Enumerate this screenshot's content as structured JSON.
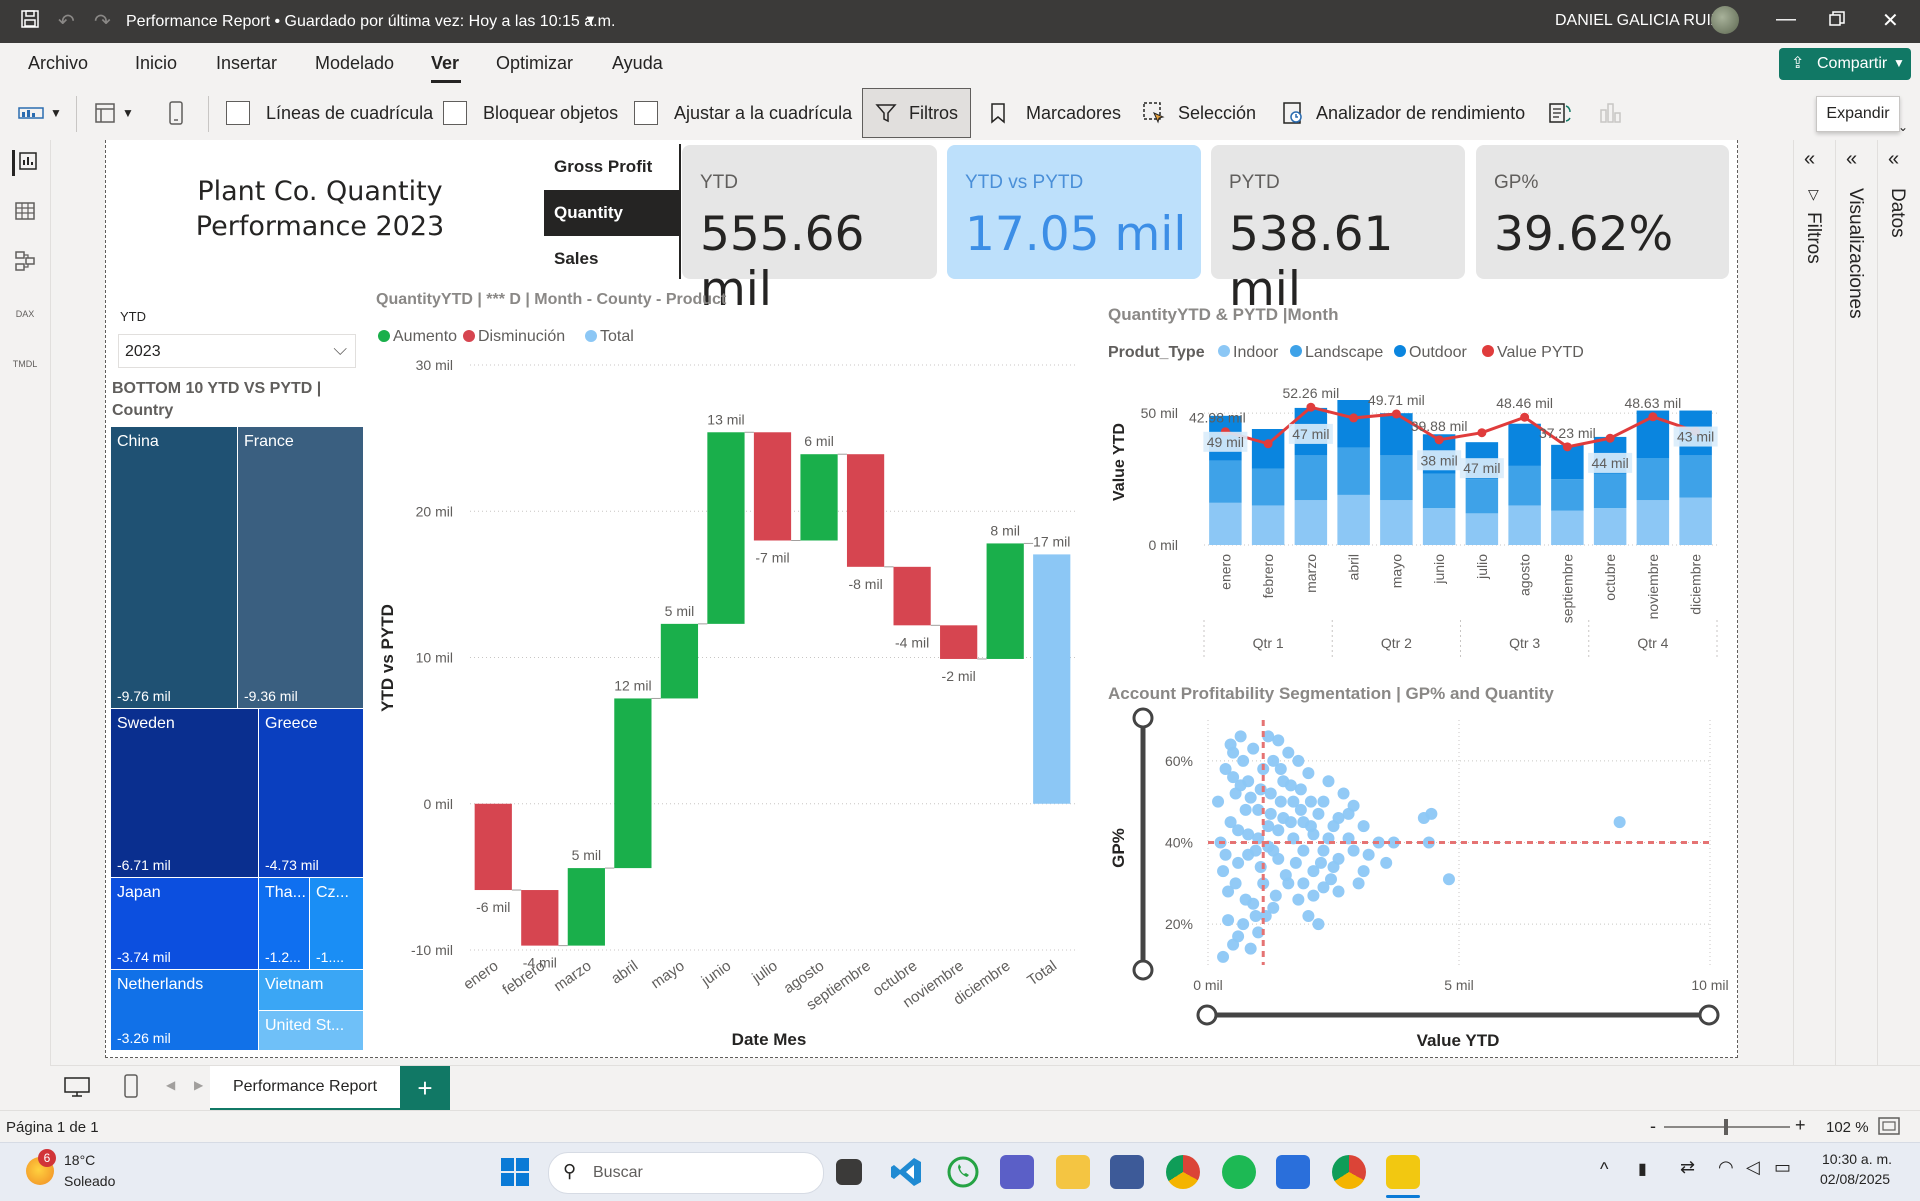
{
  "titlebar": {
    "title": "Performance Report • Guardado por última vez: Hoy a las 10:15 a.m.",
    "user": "DANIEL GALICIA RUIZ"
  },
  "menu": [
    "Archivo",
    "Inicio",
    "Insertar",
    "Modelado",
    "Ver",
    "Optimizar",
    "Ayuda"
  ],
  "share_label": "Compartir",
  "ribbon": {
    "gridlines": "Líneas de cuadrícula",
    "lock": "Bloquear objetos",
    "snap": "Ajustar a la cuadrícula",
    "filters": "Filtros",
    "bookmarks": "Marcadores",
    "selection": "Selección",
    "perf": "Analizador de rendimiento"
  },
  "tooltip": "Expandir",
  "panes": {
    "filters": "Filtros",
    "visualizations": "Visualizaciones",
    "data": "Datos"
  },
  "report": {
    "title_line1": "Plant Co. Quantity",
    "title_line2": "Performance 2023",
    "slicer_buttons": [
      "Gross Profit",
      "Quantity",
      "Sales"
    ],
    "year_slicer": {
      "label": "YTD",
      "value": "2023"
    },
    "treemap_title_l1": "BOTTOM 10 YTD VS PYTD |",
    "treemap_title_l2": "Country"
  },
  "cards": [
    {
      "label": "YTD",
      "value": "555.66 mil"
    },
    {
      "label": "YTD vs PYTD",
      "value": "17.05 mil"
    },
    {
      "label": "PYTD",
      "value": "538.61 mil"
    },
    {
      "label": "GP%",
      "value": "39.62%"
    }
  ],
  "treemap": [
    {
      "name": "China",
      "value": "-9.76 mil",
      "color": "#1f5173"
    },
    {
      "name": "France",
      "value": "-9.36 mil",
      "color": "#3a5f80"
    },
    {
      "name": "Sweden",
      "value": "-6.71 mil",
      "color": "#0a2f8f"
    },
    {
      "name": "Greece",
      "value": "-4.73 mil",
      "color": "#0a3fbf"
    },
    {
      "name": "Japan",
      "value": "-3.74 mil",
      "color": "#0c4fdf"
    },
    {
      "name": "Tha...",
      "value": "-1.2...",
      "color": "#0f6ff0"
    },
    {
      "name": "Cz...",
      "value": "-1....",
      "color": "#1a8ef5"
    },
    {
      "name": "Netherlands",
      "value": "-3.26 mil",
      "color": "#1171e8"
    },
    {
      "name": "Vietnam",
      "value": "",
      "color": "#3aa6f5"
    },
    {
      "name": "United St...",
      "value": "",
      "color": "#6fc0f8"
    }
  ],
  "chart_data": [
    {
      "type": "waterfall",
      "title": "QuantityYTD | *** D | Month - County - Product",
      "legend": [
        "Aumento",
        "Disminución",
        "Total"
      ],
      "colors": {
        "increase": "#1aaf4b",
        "decrease": "#d64550",
        "total": "#8cc7f5"
      },
      "xlabel": "Date Mes",
      "ylabel": "YTD vs PYTD",
      "ylim": [
        -10,
        30
      ],
      "yticks": [
        "30 mil",
        "20 mil",
        "10 mil",
        "0 mil",
        "-10 mil"
      ],
      "ytick_values": [
        30,
        20,
        10,
        0,
        -10
      ],
      "categories": [
        "enero",
        "febrero",
        "marzo",
        "abril",
        "mayo",
        "junio",
        "julio",
        "agosto",
        "septiembre",
        "octubre",
        "noviembre",
        "diciembre",
        "Total"
      ],
      "values": [
        -5.9,
        -3.8,
        5.3,
        11.6,
        5.1,
        13.1,
        -7.4,
        5.9,
        -7.7,
        -4.0,
        -2.3,
        7.9,
        17.05
      ],
      "data_labels": [
        "-6 mil",
        "-4 mil",
        "5 mil",
        "12 mil",
        "5 mil",
        "13 mil",
        "-7 mil",
        "6 mil",
        "-8 mil",
        "-4 mil",
        "-2 mil",
        "8 mil",
        "17 mil"
      ]
    },
    {
      "type": "bar",
      "stacked": true,
      "title": "QuantityYTD & PYTD |Month",
      "legend_title": "Produt_Type",
      "ylabel": "Value YTD",
      "ylim": [
        0,
        55
      ],
      "yticks": [
        "50 mil",
        "0 mil"
      ],
      "ytick_values": [
        50,
        0
      ],
      "categories": [
        "enero",
        "febrero",
        "marzo",
        "abril",
        "mayo",
        "junio",
        "julio",
        "agosto",
        "septiembre",
        "octubre",
        "noviembre",
        "diciembre"
      ],
      "quarters": [
        "Qtr 1",
        "Qtr 2",
        "Qtr 3",
        "Qtr 4"
      ],
      "series": [
        {
          "name": "Indoor",
          "color": "#8cc7f5",
          "values": [
            16,
            15,
            17,
            19,
            17,
            14,
            12,
            15,
            13,
            14,
            17,
            18
          ]
        },
        {
          "name": "Landscape",
          "color": "#3ea2e8",
          "values": [
            16,
            14,
            17,
            18,
            17,
            13,
            13,
            15,
            12,
            13,
            16,
            16
          ]
        },
        {
          "name": "Outdoor",
          "color": "#0a85df",
          "values": [
            17,
            15,
            18,
            18,
            16,
            15,
            14,
            16,
            13,
            14,
            18,
            17
          ]
        }
      ],
      "line_series": {
        "name": "Value PYTD",
        "color": "#e03c3c",
        "values": [
          42.98,
          38.4,
          52.26,
          48.2,
          49.71,
          39.88,
          42.6,
          48.46,
          37.23,
          40.5,
          48.63,
          43.1
        ]
      },
      "bar_labels": [
        "49 mil",
        "",
        "47 mil",
        "",
        "",
        "38 mil",
        "47 mil",
        "",
        "",
        "44 mil",
        "",
        "43 mil"
      ],
      "line_labels": [
        "42.98 mil",
        "",
        "52.26 mil",
        "",
        "49.71 mil",
        "39.88 mil",
        "",
        "48.46 mil",
        "37.23 mil",
        "",
        "48.63 mil",
        ""
      ]
    },
    {
      "type": "scatter",
      "title": "Account Profitability Segmentation | GP% and Quantity",
      "xlabel": "Value YTD",
      "ylabel": "GP%",
      "xlim": [
        0,
        10
      ],
      "ylim": [
        10,
        70
      ],
      "xticks": [
        "0 mil",
        "5 mil",
        "10 mil"
      ],
      "xtick_values": [
        0,
        5,
        10
      ],
      "yticks": [
        "60%",
        "40%",
        "20%"
      ],
      "ytick_values": [
        60,
        40,
        20
      ],
      "ref_x": 1.1,
      "ref_y": 40,
      "color": "#8cc7f5",
      "points": [
        [
          4.3,
          46
        ],
        [
          4.45,
          47
        ],
        [
          4.4,
          40
        ],
        [
          4.8,
          31
        ],
        [
          8.2,
          45
        ],
        [
          3.7,
          40
        ],
        [
          3.55,
          35
        ],
        [
          3.4,
          40
        ],
        [
          3.1,
          44
        ],
        [
          2.9,
          49
        ],
        [
          2.8,
          41
        ],
        [
          2.6,
          36
        ],
        [
          2.5,
          34
        ],
        [
          3.0,
          30
        ],
        [
          3.1,
          33
        ],
        [
          2.2,
          47
        ],
        [
          2.4,
          55
        ],
        [
          2.3,
          50
        ],
        [
          2.0,
          57
        ],
        [
          1.8,
          60
        ],
        [
          1.6,
          62
        ],
        [
          1.4,
          65
        ],
        [
          1.2,
          66
        ],
        [
          1.5,
          55
        ],
        [
          1.7,
          50
        ],
        [
          1.9,
          45
        ],
        [
          2.1,
          42
        ],
        [
          2.3,
          38
        ],
        [
          2.5,
          44
        ],
        [
          2.7,
          52
        ],
        [
          1.3,
          38
        ],
        [
          1.1,
          30
        ],
        [
          0.9,
          25
        ],
        [
          0.7,
          20
        ],
        [
          0.5,
          15
        ],
        [
          0.3,
          12
        ],
        [
          0.4,
          28
        ],
        [
          0.6,
          35
        ],
        [
          0.8,
          42
        ],
        [
          0.2,
          50
        ],
        [
          0.35,
          58
        ],
        [
          0.5,
          62
        ],
        [
          0.65,
          66
        ],
        [
          0.8,
          55
        ],
        [
          1.0,
          48
        ],
        [
          1.2,
          44
        ],
        [
          1.4,
          36
        ],
        [
          1.6,
          30
        ],
        [
          1.8,
          26
        ],
        [
          2.0,
          22
        ],
        [
          2.2,
          20
        ],
        [
          1.3,
          24
        ],
        [
          1.5,
          46
        ],
        [
          1.7,
          41
        ],
        [
          1.9,
          38
        ],
        [
          2.1,
          33
        ],
        [
          2.3,
          29
        ],
        [
          2.6,
          28
        ],
        [
          2.9,
          38
        ],
        [
          3.2,
          37
        ],
        [
          0.45,
          45
        ],
        [
          0.55,
          52
        ],
        [
          0.75,
          48
        ],
        [
          0.95,
          38
        ],
        [
          1.05,
          34
        ],
        [
          1.25,
          52
        ],
        [
          1.45,
          58
        ],
        [
          1.65,
          45
        ],
        [
          1.85,
          53
        ],
        [
          2.05,
          50
        ],
        [
          0.25,
          40
        ],
        [
          0.3,
          33
        ],
        [
          0.4,
          21
        ],
        [
          0.6,
          17
        ],
        [
          0.85,
          14
        ],
        [
          1.0,
          18
        ],
        [
          1.15,
          22
        ],
        [
          1.35,
          27
        ],
        [
          1.55,
          32
        ],
        [
          1.75,
          35
        ],
        [
          0.5,
          56
        ],
        [
          0.7,
          60
        ],
        [
          0.9,
          63
        ],
        [
          1.1,
          58
        ],
        [
          1.3,
          60
        ],
        [
          0.6,
          43
        ],
        [
          0.8,
          37
        ],
        [
          1.0,
          41
        ],
        [
          1.2,
          39
        ],
        [
          1.4,
          43
        ],
        [
          2.4,
          41
        ],
        [
          2.6,
          46
        ],
        [
          2.8,
          47
        ],
        [
          1.9,
          30
        ],
        [
          2.1,
          27
        ],
        [
          0.35,
          37
        ],
        [
          0.55,
          30
        ],
        [
          0.75,
          26
        ],
        [
          0.95,
          22
        ],
        [
          0.45,
          64
        ],
        [
          0.65,
          54
        ],
        [
          0.85,
          51
        ],
        [
          1.05,
          53
        ],
        [
          1.25,
          47
        ],
        [
          1.45,
          50
        ],
        [
          1.65,
          54
        ],
        [
          1.85,
          48
        ],
        [
          2.05,
          44
        ],
        [
          2.25,
          35
        ],
        [
          2.45,
          31
        ]
      ]
    }
  ],
  "scatter_range": {
    "x": [
      0,
      10
    ],
    "y": [
      10,
      70
    ]
  },
  "pages": {
    "tab": "Performance Report",
    "counter": "Página 1 de 1",
    "zoom": "102 %"
  },
  "taskbar": {
    "weather_temp": "18°C",
    "weather_text": "Soleado",
    "weather_badge": "6",
    "search": "Buscar",
    "time": "10:30 a. m.",
    "date": "02/08/2025"
  }
}
